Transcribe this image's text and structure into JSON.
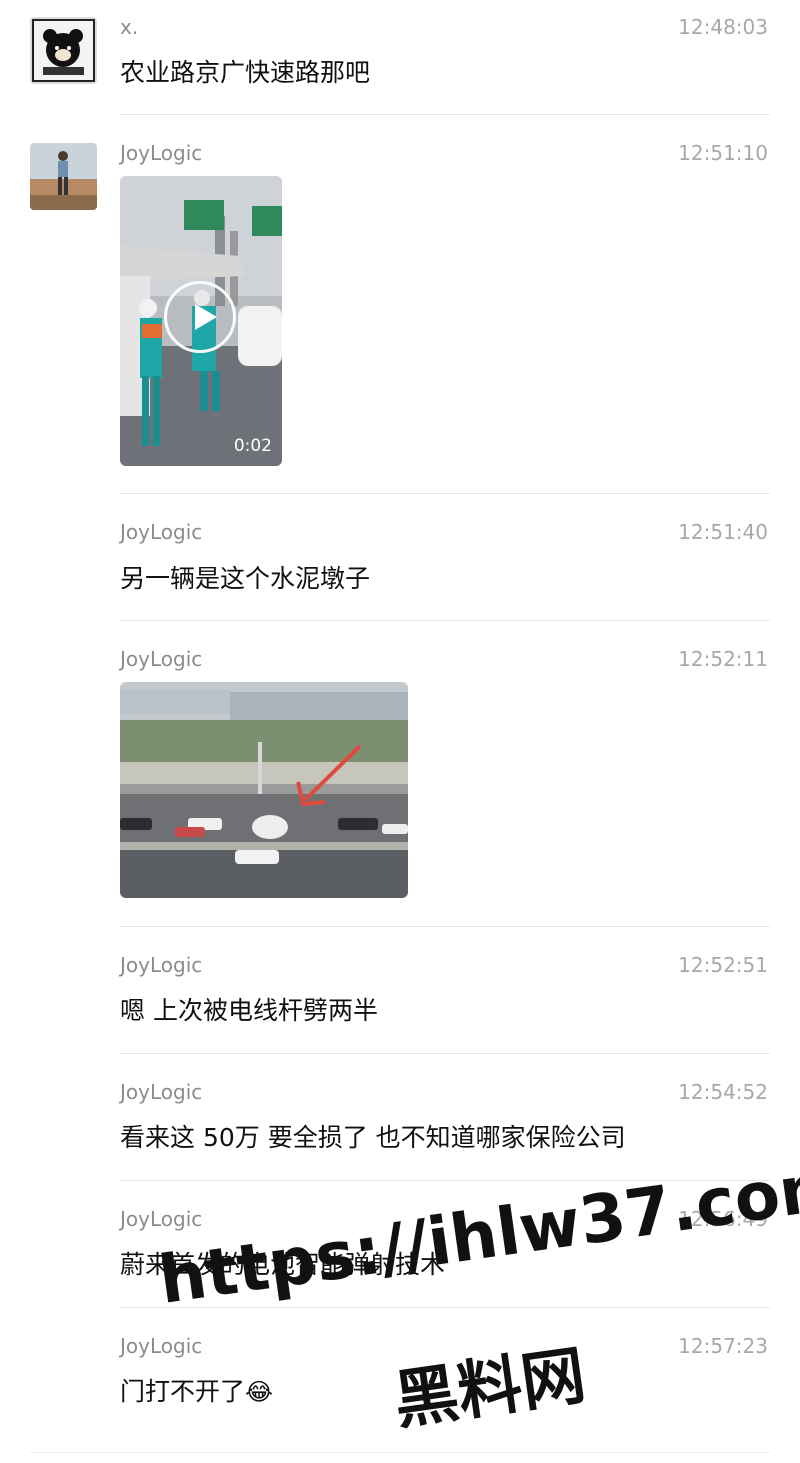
{
  "messages": [
    {
      "sender": "x.",
      "time": "12:48:03",
      "text": "农业路京广快速路那吧"
    },
    {
      "sender": "JoyLogic",
      "time": "12:51:10",
      "video_duration": "0:02"
    },
    {
      "sender": "JoyLogic",
      "time": "12:51:40",
      "text": "另一辆是这个水泥墩子"
    },
    {
      "sender": "JoyLogic",
      "time": "12:52:11"
    },
    {
      "sender": "JoyLogic",
      "time": "12:52:51",
      "text": "嗯 上次被电线杆劈两半"
    },
    {
      "sender": "JoyLogic",
      "time": "12:54:52",
      "text": "看来这 50万 要全损了   也不知道哪家保险公司"
    },
    {
      "sender": "JoyLogic",
      "time": "12:56:49",
      "text": "蔚来首发的电池智能弹射技术"
    },
    {
      "sender": "JoyLogic",
      "time": "12:57:23",
      "text": "门打不开了",
      "emoji": "😂"
    }
  ],
  "watermark": {
    "url": "https://ihlw37.com",
    "name": "黑料网"
  },
  "colors": {
    "sender": "#8c8c8c",
    "time": "#a8a8a8",
    "divider": "#e6e6e6"
  }
}
